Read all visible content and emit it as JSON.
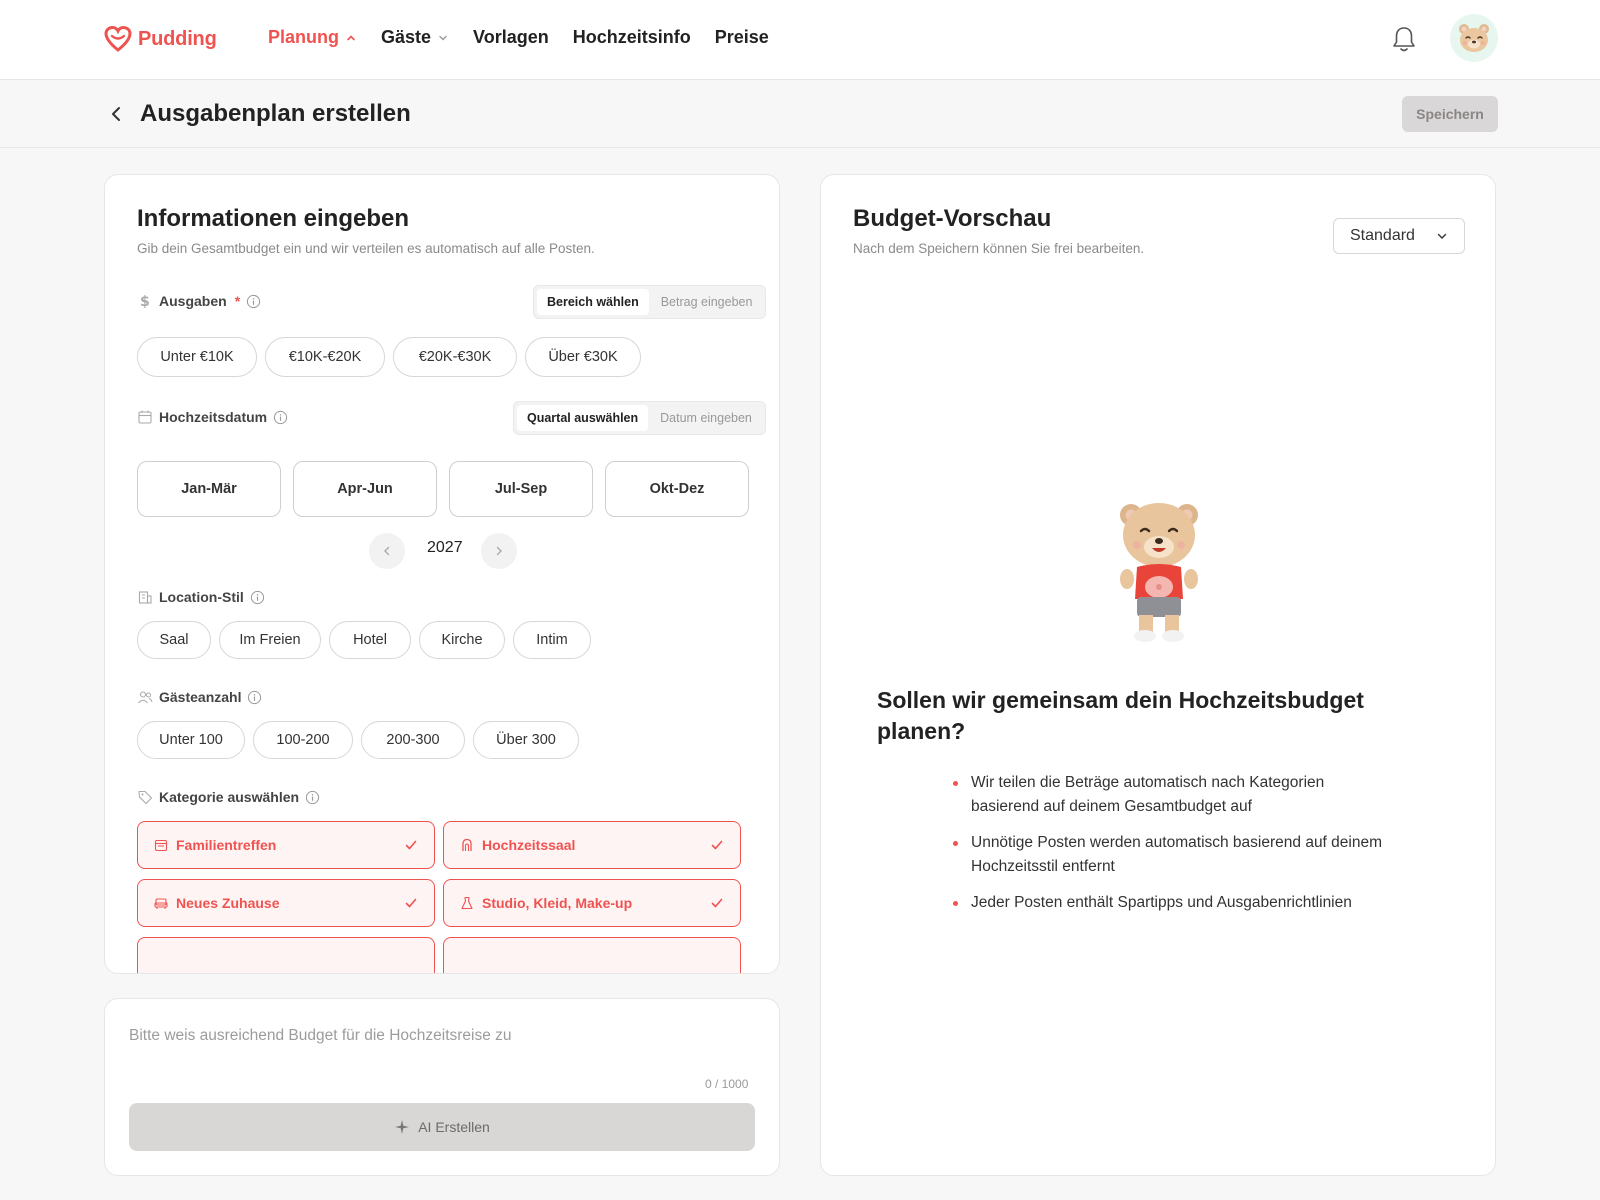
{
  "brand": {
    "name": "Pudding",
    "accent": "#ef5350"
  },
  "nav": {
    "items": [
      {
        "label": "Planung",
        "active": true,
        "has_chevron": true,
        "chevron": "chevron-up-icon"
      },
      {
        "label": "Gäste",
        "active": false,
        "has_chevron": true,
        "chevron": "chevron-down-icon"
      },
      {
        "label": "Vorlagen",
        "active": false,
        "has_chevron": false
      },
      {
        "label": "Hochzeitsinfo",
        "active": false,
        "has_chevron": false
      },
      {
        "label": "Preise",
        "active": false,
        "has_chevron": false
      }
    ]
  },
  "header": {
    "title": "Ausgabenplan erstellen",
    "save_label": "Speichern"
  },
  "form": {
    "title": "Informationen eingeben",
    "subtitle": "Gib dein Gesamtbudget ein und wir verteilen es automatisch auf alle Posten.",
    "expenses": {
      "label": "Ausgaben",
      "required_mark": "*",
      "toggle": [
        "Bereich wählen",
        "Betrag eingeben"
      ],
      "toggle_active": 0,
      "options": [
        "Unter €10K",
        "€10K-€20K",
        "€20K-€30K",
        "Über €30K"
      ]
    },
    "date": {
      "label": "Hochzeitsdatum",
      "toggle": [
        "Quartal auswählen",
        "Datum eingeben"
      ],
      "toggle_active": 0,
      "quarters": [
        "Jan-Mär",
        "Apr-Jun",
        "Jul-Sep",
        "Okt-Dez"
      ],
      "year": "2027"
    },
    "location": {
      "label": "Location-Stil",
      "options": [
        "Saal",
        "Im Freien",
        "Hotel",
        "Kirche",
        "Intim"
      ]
    },
    "guests": {
      "label": "Gästeanzahl",
      "options": [
        "Unter 100",
        "100-200",
        "200-300",
        "Über 300"
      ]
    },
    "category": {
      "label": "Kategorie auswählen",
      "items": [
        {
          "label": "Familientreffen",
          "icon": "calendar-icon",
          "selected": true
        },
        {
          "label": "Hochzeitssaal",
          "icon": "arch-icon",
          "selected": true
        },
        {
          "label": "Neues Zuhause",
          "icon": "sofa-icon",
          "selected": true
        },
        {
          "label": "Studio, Kleid, Make-up",
          "icon": "dress-icon",
          "selected": true
        }
      ]
    }
  },
  "ai": {
    "placeholder": "Bitte weis ausreichend Budget für die Hochzeitsreise zu",
    "counter": "0 / 1000",
    "button_label": "AI Erstellen"
  },
  "preview": {
    "title": "Budget-Vorschau",
    "subtitle": "Nach dem Speichern können Sie frei bearbeiten.",
    "dropdown_value": "Standard",
    "cta_title": "Sollen wir gemeinsam dein Hochzeitsbudget planen?",
    "bullets": [
      "Wir teilen die Beträge automatisch nach Kategorien basierend auf deinem Gesamtbudget auf",
      "Unnötige Posten werden automatisch basierend auf deinem Hochzeitsstil entfernt",
      "Jeder Posten enthält Spartipps und Ausgabenrichtlinien"
    ]
  }
}
